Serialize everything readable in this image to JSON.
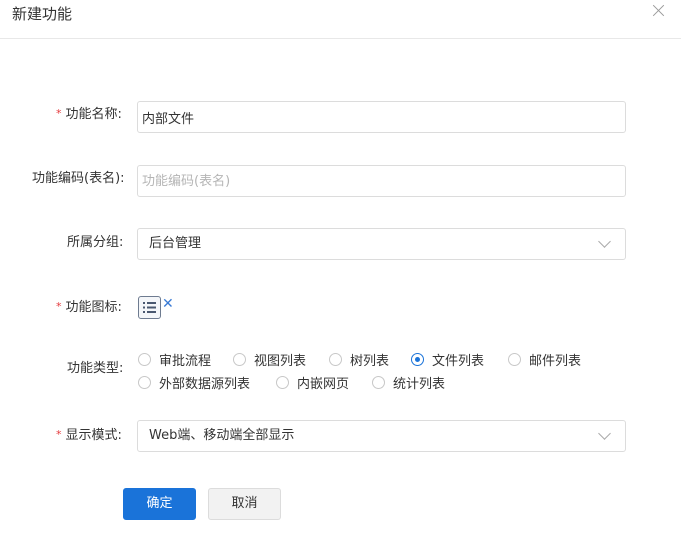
{
  "dialog": {
    "title": "新建功能",
    "close_icon": "close-icon"
  },
  "form": {
    "required_mark": "*",
    "name": {
      "label": "功能名称:",
      "value": "内部文件"
    },
    "code": {
      "label": "功能编码(表名):",
      "value": "",
      "placeholder": "功能编码(表名)"
    },
    "group": {
      "label": "所属分组:",
      "value": "后台管理"
    },
    "icon": {
      "label": "功能图标:",
      "icon": "list-icon",
      "clear": "✕"
    },
    "type": {
      "label": "功能类型:",
      "options": [
        "审批流程",
        "视图列表",
        "树列表",
        "文件列表",
        "邮件列表",
        "外部数据源列表",
        "内嵌网页",
        "统计列表"
      ],
      "selected": "文件列表"
    },
    "display": {
      "label": "显示模式:",
      "value": "Web端、移动端全部显示"
    }
  },
  "buttons": {
    "confirm": "确定",
    "cancel": "取消"
  },
  "colors": {
    "primary": "#1a73d9",
    "required": "#e4393c",
    "border": "#dcdcdc"
  }
}
